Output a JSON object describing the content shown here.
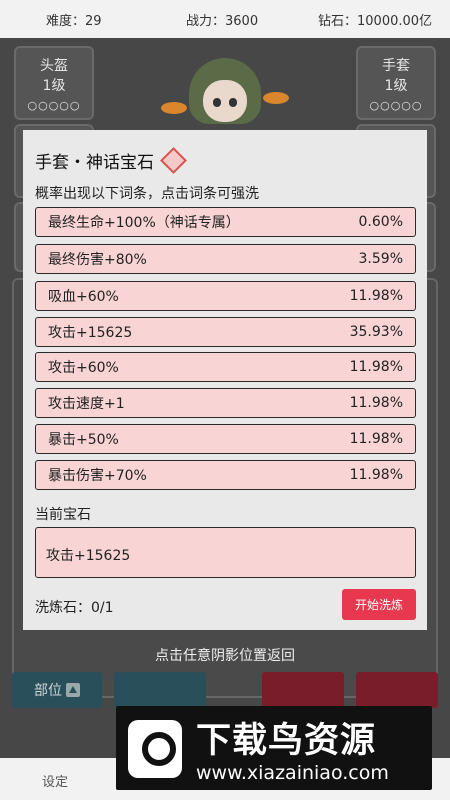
{
  "topbar": {
    "difficulty": "难度：29",
    "power": "战力：3600",
    "diamond": "钻石：10000.00亿"
  },
  "slots": {
    "helmet": {
      "name": "头盔",
      "level": "1级",
      "dots": "○○○○○"
    },
    "gloves": {
      "name": "手套",
      "level": "1级",
      "dots": "○○○○○"
    }
  },
  "bottom_buttons": {
    "position": "部位"
  },
  "tabbar": {
    "settings": "设定"
  },
  "modal": {
    "title": "手套・神话宝石",
    "subtitle": "概率出现以下词条，点击词条可强洗",
    "affixes": [
      {
        "name": "最终生命+100%（神话专属）",
        "pct": "0.60%"
      },
      {
        "name": "最终伤害+80%",
        "pct": "3.59%"
      },
      {
        "name": "吸血+60%",
        "pct": "11.98%"
      },
      {
        "name": "攻击+15625",
        "pct": "35.93%"
      },
      {
        "name": "攻击+60%",
        "pct": "11.98%"
      },
      {
        "name": "攻击速度+1",
        "pct": "11.98%"
      },
      {
        "name": "暴击+50%",
        "pct": "11.98%"
      },
      {
        "name": "暴击伤害+70%",
        "pct": "11.98%"
      }
    ],
    "current_label": "当前宝石",
    "current_value": "攻击+15625",
    "stone_label": "洗炼石：0/1",
    "start_button": "开始洗炼",
    "gem_color": "#d9534f"
  },
  "hint": "点击任意阴影位置返回",
  "watermark": {
    "title": "下载鸟资源",
    "url": "www.xiazainiao.com"
  }
}
